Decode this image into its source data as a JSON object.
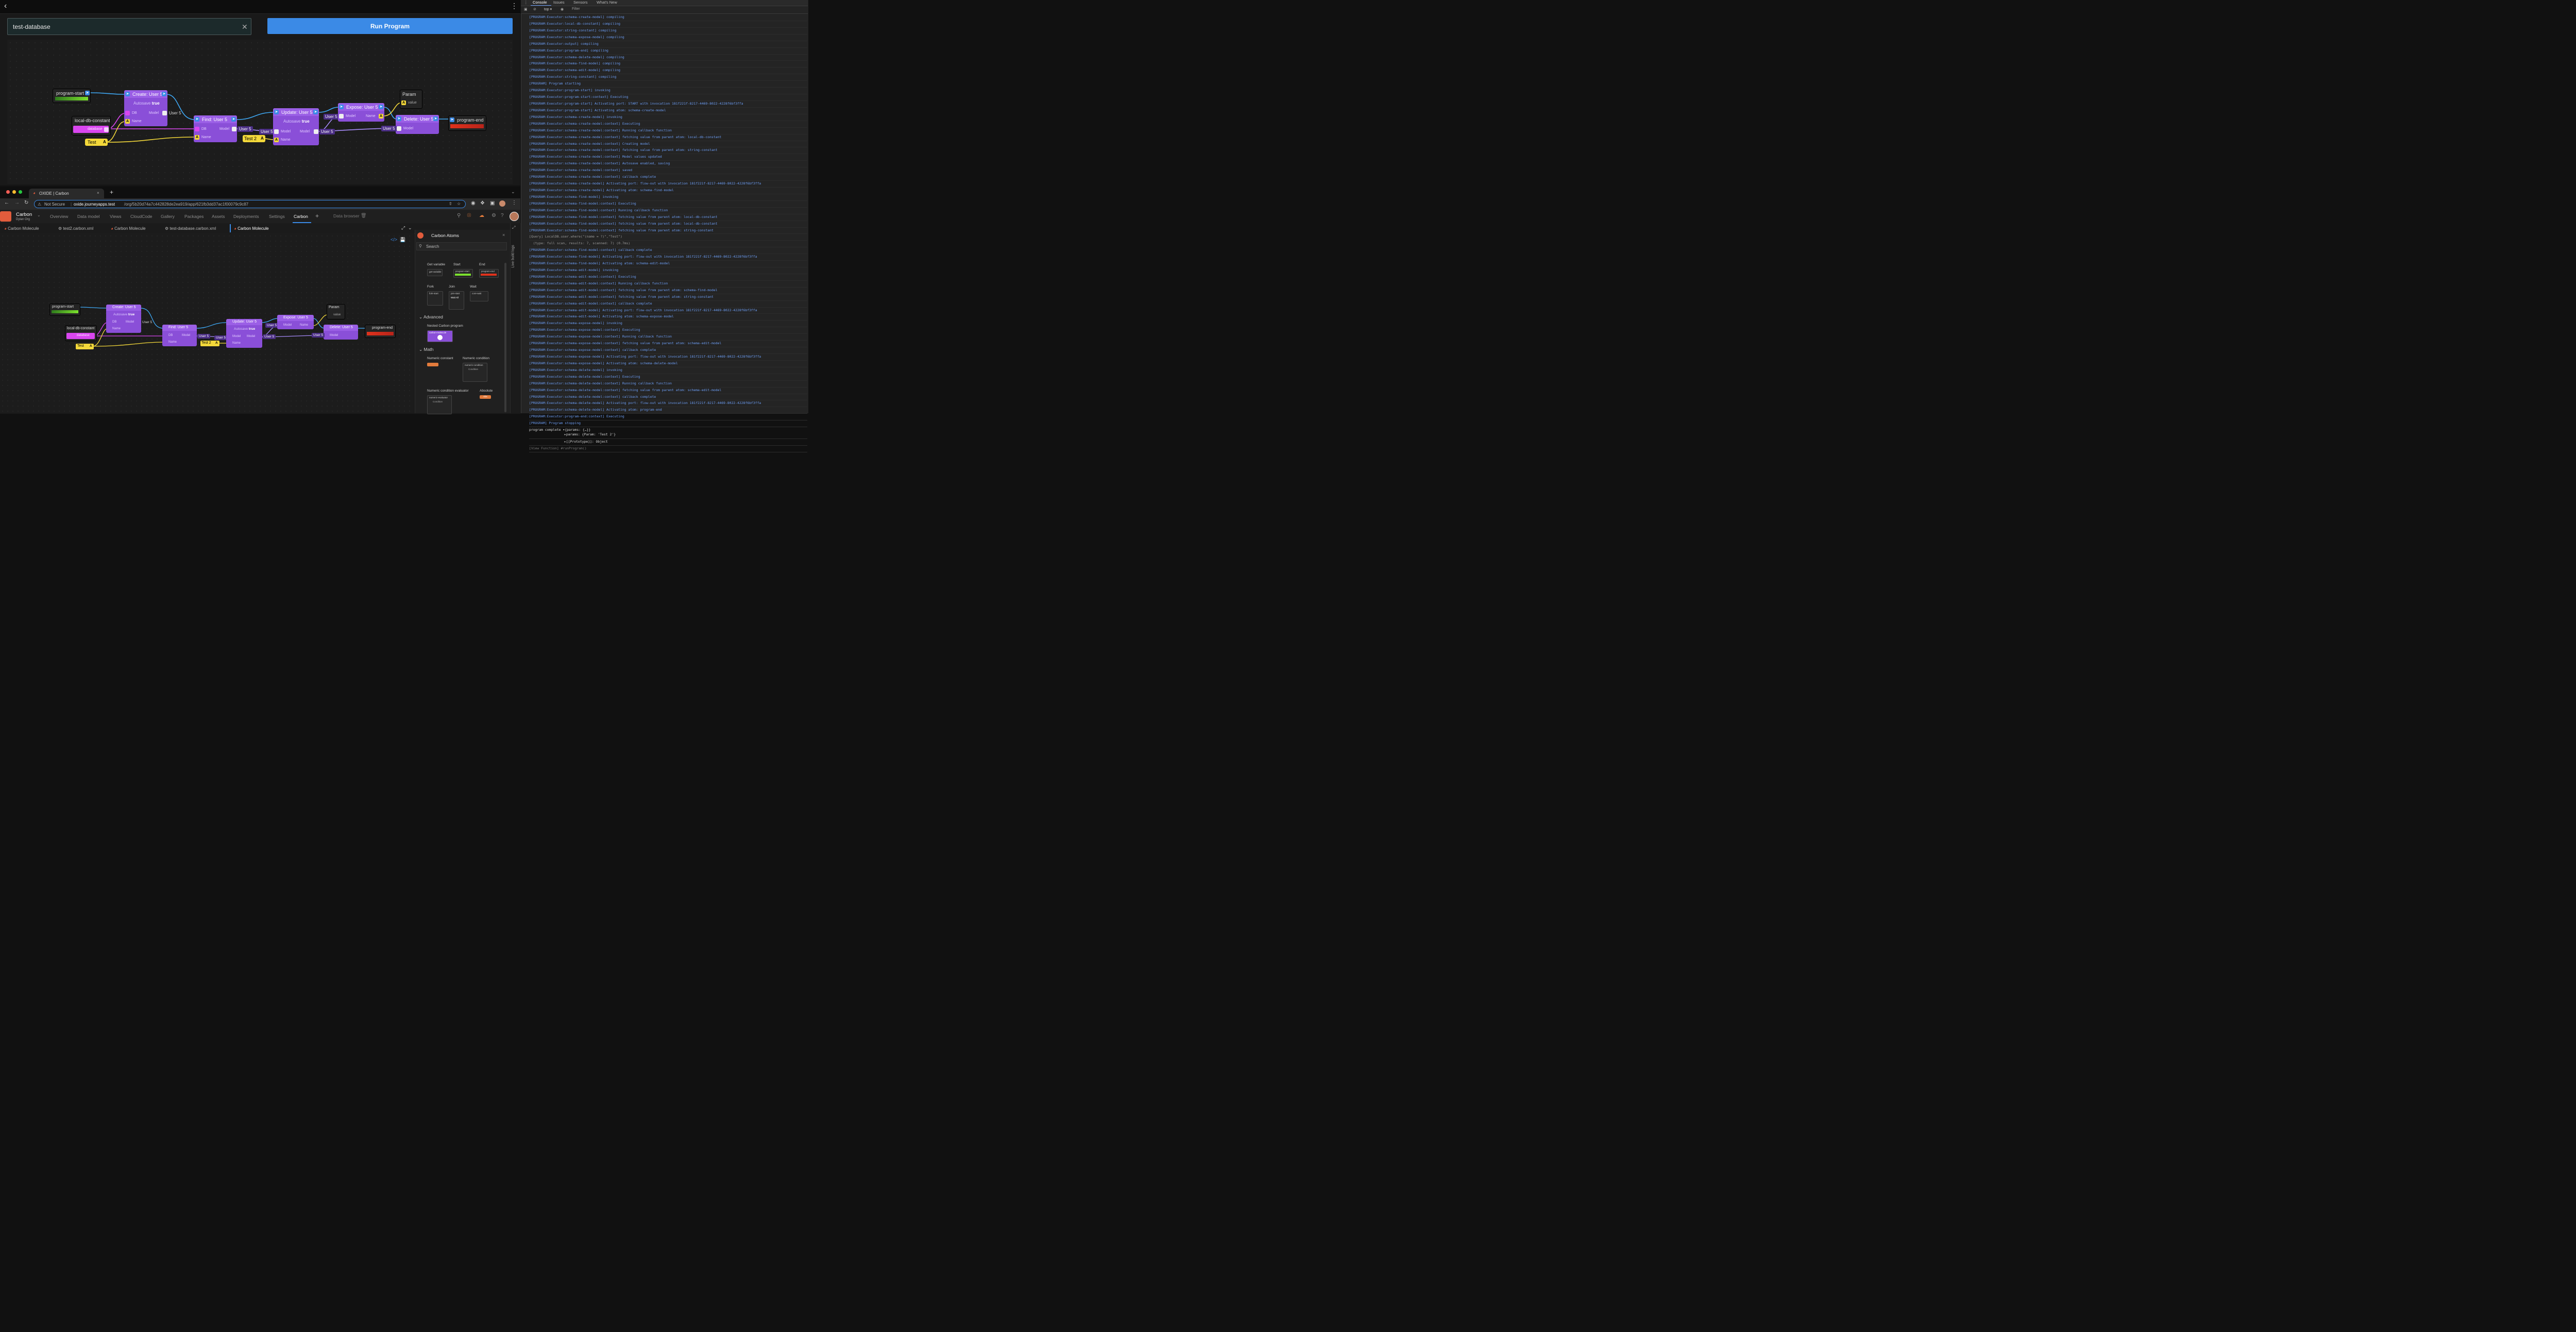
{
  "top_app": {
    "back_icon": "chevron-left-icon",
    "menu_icon": "kebab-menu-icon",
    "database_input_value": "test-database",
    "clear_icon": "close-icon",
    "run_button": "Run Program"
  },
  "flow": {
    "program_start": "program-start",
    "local_db_constant": "local-db-constant",
    "database_port": "database",
    "create_title": "Create: User 5",
    "autosave_label": "Autosave",
    "autosave_value": "true",
    "db_port": "DB",
    "model_port": "Model",
    "name_port": "Name",
    "user5": "User 5",
    "test_const": "Test",
    "find_title": "Find: User 5",
    "update_title": "Update: User 5",
    "test2_const": "Test 2",
    "expose_title": "Expose: User 5",
    "param_title": "Param",
    "value_port": "value",
    "delete_title": "Delete: User 5",
    "program_end": "program-end",
    "a_glyph": "A"
  },
  "browser": {
    "tab_title": "OXIDE | Carbon",
    "new_tab": "+",
    "not_secure": "Not Secure",
    "url_host": "oxide.journeyapps.test",
    "url_path": "/org/5b20d74a7c442828de2ea919/app/621fb3dd37ac1f00079c9c87"
  },
  "app": {
    "logo_name": "Carbon",
    "org": "Dylan Org",
    "nav": [
      "Overview",
      "Data model",
      "Views",
      "CloudCode",
      "Gallery",
      "Packages",
      "Assets",
      "Deployments",
      "Settings",
      "Carbon"
    ],
    "add_tab": "+",
    "data_browser": "Data browser",
    "doc_tabs": [
      "Carbon Molecule",
      "test2.carbon.xml",
      "Carbon Molecule",
      "test-database.carbon.xml",
      "Carbon Molecule"
    ]
  },
  "atoms_panel": {
    "title": "Carbon Atoms",
    "search_placeholder": "Search",
    "live_build_logs": "Live build logs",
    "items": {
      "get_variable": "Get variable",
      "start": "Start",
      "end": "End",
      "fork": "Fork",
      "join": "Join",
      "wait": "Wait",
      "nested": "Nested Carbon program",
      "numeric_constant": "Numeric constant",
      "numeric_condition": "Numeric condition",
      "numeric_condition_evaluator": "Numeric condition evaluator",
      "absolute": "Absolute"
    },
    "thumbs": {
      "get_variable": "get-variable",
      "start": "program-start",
      "end": "program-end",
      "fork": "fork-start",
      "join": "join-start",
      "join_wait": "Wait All",
      "wait": "core-wait",
      "nested": "carbon-molecule",
      "numeric_condition": "numeric-condition",
      "condition": "Condition",
      "numeric_evaluator": "numeric-evaluator",
      "abs": "Abs"
    },
    "sections": {
      "advanced": "Advanced",
      "math": "Math"
    }
  },
  "devtools": {
    "tabs": [
      "Console",
      "Issues",
      "Sensors",
      "What's New"
    ],
    "context": "top",
    "filter_placeholder": "Filter",
    "logs": [
      "[PROGRAM:Executor:schema-create-model] compiling",
      "[PROGRAM:Executor:local-db-constant] compiling",
      "[PROGRAM:Executor:string-constant] compiling",
      "[PROGRAM:Executor:schema-expose-model] compiling",
      "[PROGRAM:Executor:output] compiling",
      "[PROGRAM:Executor:program-end] compiling",
      "[PROGRAM:Executor:schema-delete-model] compiling",
      "[PROGRAM:Executor:schema-find-model] compiling",
      "[PROGRAM:Executor:schema-edit-model] compiling",
      "[PROGRAM:Executor:string-constant] compiling",
      "[PROGRAM] Program starting",
      "[PROGRAM:Executor:program-start] invoking",
      "[PROGRAM:Executor:program-start:context] Executing",
      "[PROGRAM:Executor:program-start] Activating port: START with invocation 181f221f-8217-4469-8022-4228f6bf3ffa",
      "[PROGRAM:Executor:program-start] Activating atom: schema-create-model",
      "[PROGRAM:Executor:schema-create-model] invoking",
      "[PROGRAM:Executor:schema-create-model:context] Executing",
      "[PROGRAM:Executor:schema-create-model:context] Running callback function",
      "[PROGRAM:Executor:schema-create-model:context] fetching value from parent atom: local-db-constant",
      "[PROGRAM:Executor:schema-create-model:context] Creating model",
      "[PROGRAM:Executor:schema-create-model:context] fetching value from parent atom: string-constant",
      "[PROGRAM:Executor:schema-create-model:context] Model values updated",
      "[PROGRAM:Executor:schema-create-model:context] Autosave enabled, saving",
      "[PROGRAM:Executor:schema-create-model:context] saved",
      "[PROGRAM:Executor:schema-create-model:context] callback complete",
      "[PROGRAM:Executor:schema-create-model] Activating port: flow-out with invocation 181f221f-8217-4469-8022-4228f6bf3ffa",
      "[PROGRAM:Executor:schema-create-model] Activating atom: schema-find-model",
      "[PROGRAM:Executor:schema-find-model] invoking",
      "[PROGRAM:Executor:schema-find-model:context] Executing",
      "[PROGRAM:Executor:schema-find-model:context] Running callback function",
      "[PROGRAM:Executor:schema-find-model:context] fetching value from parent atom: local-db-constant",
      "[PROGRAM:Executor:schema-find-model:context] fetching value from parent atom: local-db-constant",
      "[PROGRAM:Executor:schema-find-model:context] fetching value from parent atom: string-constant"
    ],
    "query_line1": "[Query] LocalDB.user.where(\"(name = ?)\",\"Test\")",
    "query_line2": "  (type: full scan, results: 7, scanned: 7) (0.7ms)",
    "logs2": [
      "[PROGRAM:Executor:schema-find-model:context] callback complete",
      "[PROGRAM:Executor:schema-find-model] Activating port: flow-out with invocation 181f221f-8217-4469-8022-4228f6bf3ffa",
      "[PROGRAM:Executor:schema-find-model] Activating atom: schema-edit-model",
      "[PROGRAM:Executor:schema-edit-model] invoking",
      "[PROGRAM:Executor:schema-edit-model:context] Executing",
      "[PROGRAM:Executor:schema-edit-model:context] Running callback function",
      "[PROGRAM:Executor:schema-edit-model:context] fetching value from parent atom: schema-find-model",
      "[PROGRAM:Executor:schema-edit-model:context] fetching value from parent atom: string-constant",
      "[PROGRAM:Executor:schema-edit-model:context] callback complete",
      "[PROGRAM:Executor:schema-edit-model] Activating port: flow-out with invocation 181f221f-8217-4469-8022-4228f6bf3ffa",
      "[PROGRAM:Executor:schema-edit-model] Activating atom: schema-expose-model",
      "[PROGRAM:Executor:schema-expose-model] invoking",
      "[PROGRAM:Executor:schema-expose-model:context] Executing",
      "[PROGRAM:Executor:schema-expose-model:context] Running callback function",
      "[PROGRAM:Executor:schema-expose-model:context] fetching value from parent atom: schema-edit-model",
      "[PROGRAM:Executor:schema-expose-model:context] callback complete",
      "[PROGRAM:Executor:schema-expose-model] Activating port: flow-out with invocation 181f221f-8217-4469-8022-4228f6bf3ffa",
      "[PROGRAM:Executor:schema-expose-model] Activating atom: schema-delete-model",
      "[PROGRAM:Executor:schema-delete-model] invoking",
      "[PROGRAM:Executor:schema-delete-model:context] Executing",
      "[PROGRAM:Executor:schema-delete-model:context] Running callback function",
      "[PROGRAM:Executor:schema-delete-model:context] fetching value from parent atom: schema-edit-model",
      "[PROGRAM:Executor:schema-delete-model:context] callback complete",
      "[PROGRAM:Executor:schema-delete-model] Activating port: flow-out with invocation 181f221f-8217-4469-8022-4228f6bf3ffa",
      "[PROGRAM:Executor:schema-delete-model] Activating atom: program-end",
      "[PROGRAM:Executor:program-end:context] Executing",
      "[PROGRAM] Program stopping"
    ],
    "complete_line": "program complete ▾{params: {…}}",
    "complete_params": "▸params: {Param: 'Test 2'}",
    "complete_proto": "▸[[Prototype]]: Object",
    "last_line": "[View Function] #runProgram()"
  }
}
